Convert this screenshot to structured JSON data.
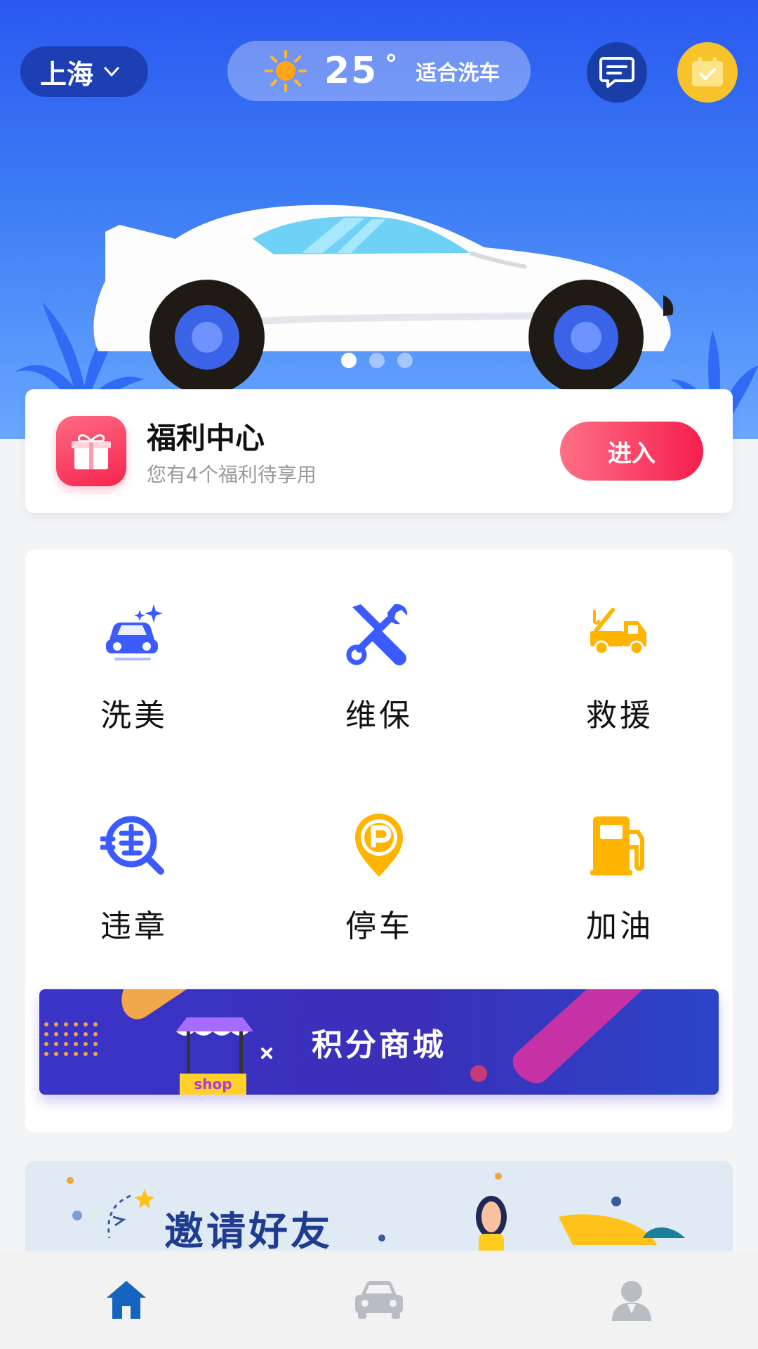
{
  "header": {
    "city": "上海",
    "temperature": "25",
    "degree_symbol": "°",
    "weather_tip": "适合洗车"
  },
  "carousel": {
    "count": 3,
    "active_index": 0
  },
  "welfare": {
    "title": "福利中心",
    "subtitle": "您有4个福利待享用",
    "enter_label": "进入"
  },
  "services": [
    {
      "label": "洗美",
      "icon": "car-wash-icon",
      "color": "#3b5bff"
    },
    {
      "label": "维保",
      "icon": "wrench-screwdriver-icon",
      "color": "#3b5bff"
    },
    {
      "label": "救援",
      "icon": "tow-truck-icon",
      "color": "#ffb400"
    },
    {
      "label": "违章",
      "icon": "violation-search-icon",
      "color": "#3b5bff"
    },
    {
      "label": "停车",
      "icon": "parking-pin-icon",
      "color": "#ffb400"
    },
    {
      "label": "加油",
      "icon": "fuel-pump-icon",
      "color": "#ffb400"
    }
  ],
  "mall": {
    "title": "积分商城",
    "shop_sign": "shop"
  },
  "invite": {
    "title": "邀请好友"
  },
  "tabs": [
    {
      "name": "home",
      "icon": "home-icon",
      "active": true
    },
    {
      "name": "car",
      "icon": "car-icon",
      "active": false
    },
    {
      "name": "profile",
      "icon": "user-icon",
      "active": false
    }
  ],
  "colors": {
    "primary_blue": "#2a58f0",
    "accent_red": "#f51f4d",
    "accent_yellow": "#ffb400",
    "tab_active": "#1565c0",
    "tab_inactive": "#b9bcc2"
  }
}
